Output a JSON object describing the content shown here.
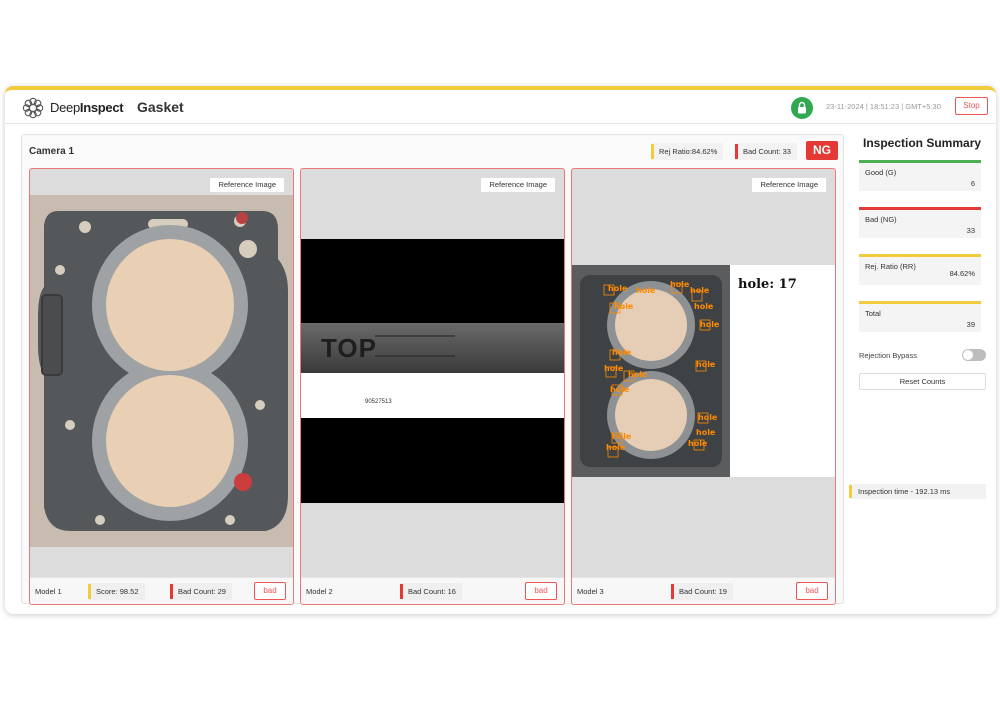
{
  "header": {
    "brand_light": "Deep",
    "brand_bold": "Inspect",
    "page_title": "Gasket",
    "datetime": "23-11-2024 | 18:51:23 | GMT+5:30",
    "stop_label": "Stop",
    "lock_icon": "lock-icon"
  },
  "camera": {
    "title": "Camera 1",
    "rej_ratio": "Rej Ratio:84.62%",
    "bad_count": "Bad Count: 33",
    "status": "NG"
  },
  "panels": [
    {
      "ref_label": "Reference Image",
      "model": "Model 1",
      "score": "Score: 98.52",
      "bad_count": "Bad Count: 29",
      "result": "bad"
    },
    {
      "ref_label": "Reference Image",
      "model": "Model 2",
      "bad_count": "Bad Count: 16",
      "result": "bad",
      "ocr_text": "TOP",
      "serial": "90527513"
    },
    {
      "ref_label": "Reference Image",
      "model": "Model 3",
      "bad_count": "Bad Count: 19",
      "result": "bad",
      "detection_summary": "hole: 17",
      "detection_label": "hole"
    }
  ],
  "summary": {
    "title": "Inspection Summary",
    "cards": [
      {
        "label": "Good (G)",
        "value": "6",
        "color": "#4caf50"
      },
      {
        "label": "Bad (NG)",
        "value": "33",
        "color": "#e53935"
      },
      {
        "label": "Rej. Ratio (RR)",
        "value": "84.62%",
        "color": "#f2cc3d"
      },
      {
        "label": "Total",
        "value": "39",
        "color": "#f2cc3d"
      }
    ],
    "bypass_label": "Rejection Bypass",
    "bypass_on": false,
    "reset_label": "Reset Counts",
    "inspection_time": "Inspection time - 192.13 ms"
  },
  "colors": {
    "accent": "#f2cc3d",
    "danger": "#e53935",
    "success": "#2fa84f"
  }
}
